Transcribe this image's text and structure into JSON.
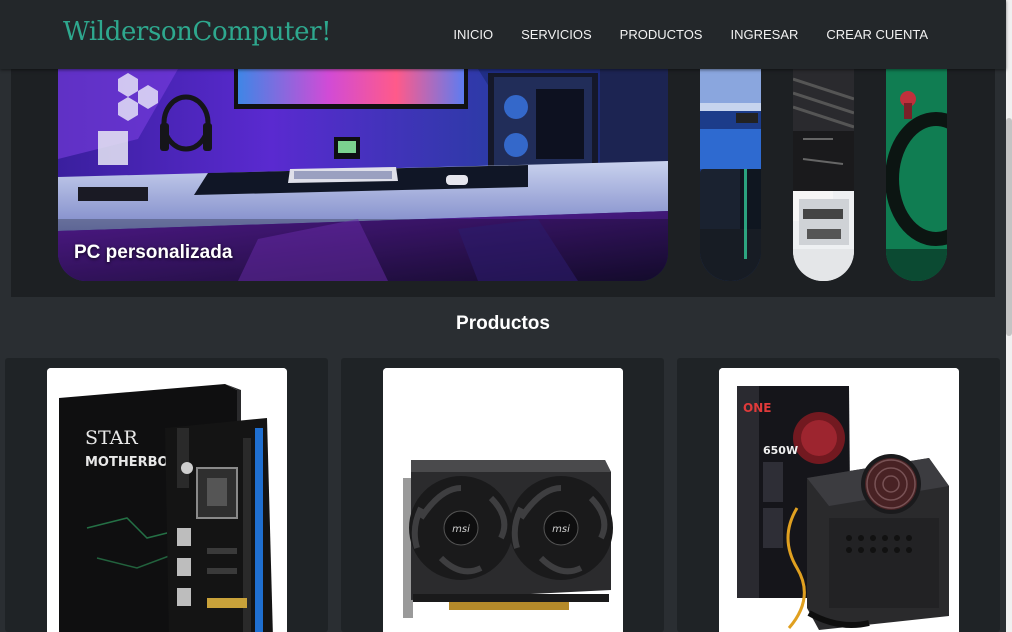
{
  "nav": {
    "brand": "WildersonComputer!",
    "items": [
      {
        "label": "INICIO"
      },
      {
        "label": "SERVICIOS"
      },
      {
        "label": "PRODUCTOS"
      },
      {
        "label": "INGRESAR"
      },
      {
        "label": "CREAR CUENTA"
      }
    ]
  },
  "slider": {
    "active_caption": "PC personalizada"
  },
  "products": {
    "title": "Productos",
    "items": [
      {
        "box_text_1": "STAR",
        "box_text_2": "MOTHERBOARD"
      },
      {
        "brand_text": "msi"
      },
      {
        "brand_text": "ONE",
        "watt_text": "650W"
      }
    ]
  },
  "colors": {
    "brand": "#2ea88e",
    "navbar_bg": "#23272a",
    "page_bg": "#2a2e32",
    "card_bg": "#1f2326"
  }
}
